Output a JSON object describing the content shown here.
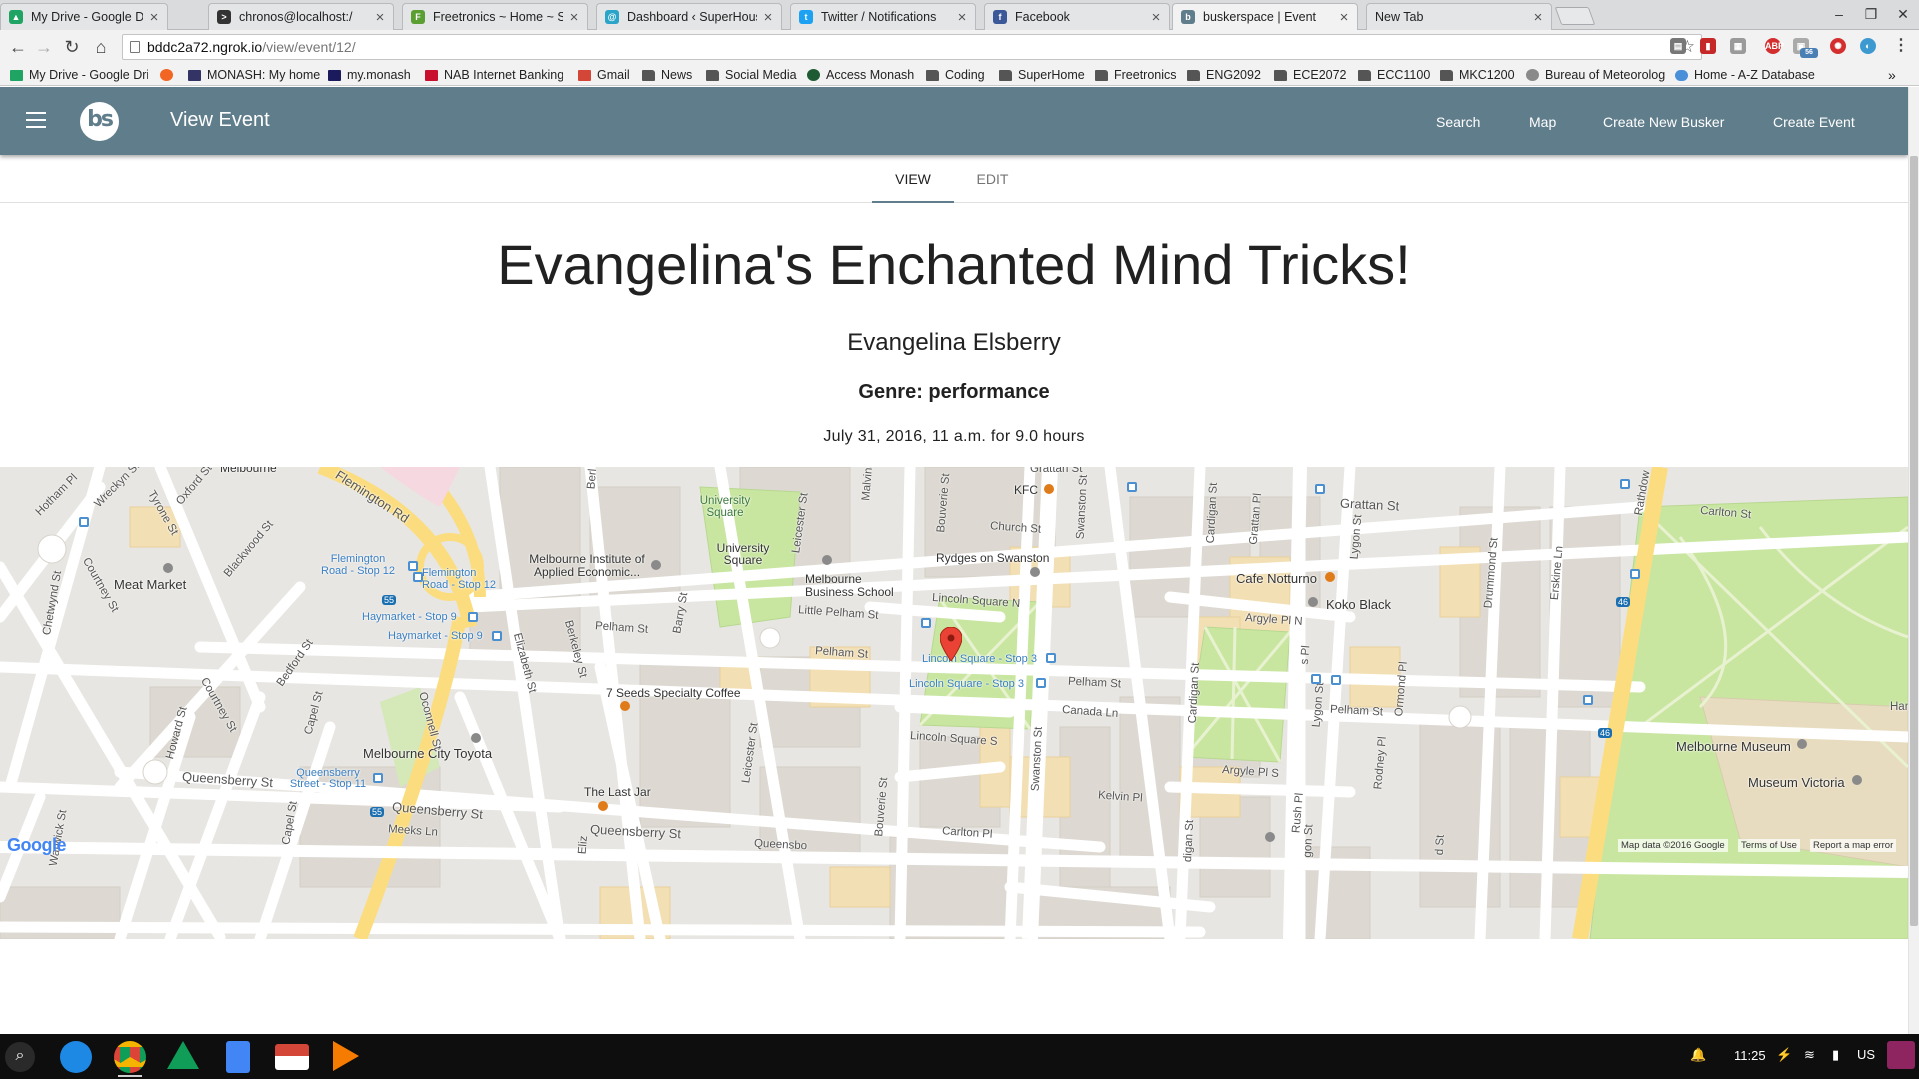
{
  "browser": {
    "tabs": [
      {
        "title": "My Drive - Google Drive",
        "favicon_color": "#1fa463",
        "active": false
      },
      {
        "title": "chronos@localhost:/",
        "favicon_color": "#333333",
        "active": false
      },
      {
        "title": "Freetronics ~ Home ~ Sh",
        "favicon_color": "#5b9e32",
        "active": false
      },
      {
        "title": "Dashboard ‹ SuperHouse",
        "favicon_color": "#2aa4c8",
        "active": false
      },
      {
        "title": "Twitter / Notifications",
        "favicon_color": "#1da1f2",
        "active": false
      },
      {
        "title": "Facebook",
        "favicon_color": "#3b5998",
        "active": false
      },
      {
        "title": "buskerspace | Event",
        "favicon_color": "#607d8b",
        "active": true
      },
      {
        "title": "New Tab",
        "favicon_color": "",
        "active": false
      }
    ],
    "url_host": "bddc2a72.ngrok.io",
    "url_path": "/view/event/12/",
    "bookmarks": [
      {
        "label": "My Drive - Google Driv",
        "icon": "drive-icon",
        "color": "#1fa463"
      },
      {
        "label": "",
        "icon": "orange-circle-icon",
        "color": "#f26522"
      },
      {
        "label": "MONASH: My home",
        "icon": "monash-icon",
        "color": "#333366"
      },
      {
        "label": "my.monash",
        "icon": "my-monash-icon",
        "color": "#1a1a5c"
      },
      {
        "label": "NAB Internet Banking",
        "icon": "nab-icon",
        "color": "#c8102e"
      },
      {
        "label": "Gmail",
        "icon": "gmail-icon",
        "color": "#d44638"
      },
      {
        "label": "News",
        "icon": "folder-icon",
        "color": "#555555"
      },
      {
        "label": "Social Media",
        "icon": "folder-icon",
        "color": "#555555"
      },
      {
        "label": "Access Monash",
        "icon": "access-monash-icon",
        "color": "#1e5a32"
      },
      {
        "label": "Coding",
        "icon": "folder-icon",
        "color": "#555555"
      },
      {
        "label": "SuperHome",
        "icon": "folder-icon",
        "color": "#555555"
      },
      {
        "label": "Freetronics",
        "icon": "folder-icon",
        "color": "#555555"
      },
      {
        "label": "ENG2092",
        "icon": "folder-icon",
        "color": "#555555"
      },
      {
        "label": "ECE2072",
        "icon": "folder-icon",
        "color": "#555555"
      },
      {
        "label": "ECC1100",
        "icon": "folder-icon",
        "color": "#555555"
      },
      {
        "label": "MKC1200",
        "icon": "folder-icon",
        "color": "#555555"
      },
      {
        "label": "Bureau of Meteorolog",
        "icon": "bom-icon",
        "color": "#8a8a8a"
      },
      {
        "label": "Home - A-Z Database",
        "icon": "cloud-icon",
        "color": "#4a90d9"
      }
    ],
    "bookmarks_overflow": "»"
  },
  "app": {
    "title": "View Event",
    "logo_text": "bs",
    "nav": [
      "Search",
      "Map",
      "Create New Busker",
      "Create Event"
    ],
    "colors": {
      "primary": "#607d8b"
    }
  },
  "view_tabs": [
    "VIEW",
    "EDIT"
  ],
  "event": {
    "title": "Evangelina's Enchanted Mind Tricks!",
    "busker": "Evangelina Elsberry",
    "genre_line": "Genre: performance",
    "time_line": "July 31, 2016, 11 a.m. for 9.0 hours"
  },
  "map": {
    "labels": {
      "melbourne": "Melbourne",
      "flemington_rd": "Flemington Rd",
      "flemington_stop_12a": "Flemington Road - Stop 12",
      "flemington_stop_12b": "Flemington Road - Stop 12",
      "meat_market": "Meat Market",
      "haymarket_9a": "Haymarket - Stop 9",
      "haymarket_9b": "Haymarket - Stop 9",
      "mia": "Melbourne Institute of Applied Economic...",
      "university_square_a": "University Square",
      "university_square_b": "University Square",
      "mbs": "Melbourne Business School",
      "little_pelham": "Little Pelham St",
      "pelham_a": "Pelham St",
      "pelham_b": "Pelham St",
      "pelham_c": "Pelham St",
      "pelham_d": "Pelham St",
      "rydges": "Rydges on Swanston",
      "kfc": "KFC",
      "grattan_a": "Grattan St",
      "grattan_b": "Grattan St",
      "church": "Church St",
      "lincoln_n": "Lincoln Square N",
      "lincoln_s": "Lincoln Square S",
      "lincoln_stop_3a": "Lincoln Square - Stop 3",
      "lincoln_stop_3b": "Lincoln Square - Stop 3",
      "cafe_notturno": "Cafe Notturno",
      "koko_black": "Koko Black",
      "argyle_n": "Argyle Pl N",
      "argyle_s": "Argyle Pl S",
      "canada_ln": "Canada Ln",
      "kelvin_pl": "Kelvin Pl",
      "carlton_st": "Carlton St",
      "carlton_pl": "Carlton Pl",
      "seven_seeds": "7 Seeds Specialty Coffee",
      "the_last_jar": "The Last Jar",
      "melbourne_city_toyota": "Melbourne City Toyota",
      "queensberry_a": "Queensberry St",
      "queensberry_b": "Queensberry St",
      "queensberry_c": "Queensberry St",
      "queensberry_d": "Queensbo",
      "queensberry_stop_11": "Queensberry Street - Stop 11",
      "melbourne_museum": "Melbourne Museum",
      "museum_victoria": "Museum Victoria",
      "rathdowne": "Rathdow",
      "hotham_pl": "Hotham Pl",
      "wreckyn": "Wreckyn St",
      "oxford": "Oxford St",
      "tyrone": "Tyrone St",
      "blackwood": "Blackwood St",
      "chetwynd": "Chetwynd St",
      "courtney_a": "Courtney St",
      "courtney_b": "Courtney St",
      "bedford": "Bedford St",
      "capel_a": "Capel St",
      "capel_b": "Capel St",
      "howard": "Howard St",
      "warwick": "Warwick St",
      "oconnell": "Oconnell St",
      "elizabeth": "Elizabeth St",
      "berkeley": "Berkeley St",
      "barry": "Barry St",
      "leicester_a": "Leicester St",
      "leicester_b": "Leicester St",
      "bouverie_a": "Bouverie St",
      "bouverie_b": "Bouverie St",
      "swanston_a": "Swanston St",
      "swanston_b": "Swanston St",
      "cardigan_a": "Cardigan St",
      "cardigan_b": "Cardigan St",
      "grattan_pl": "Grattan Pl",
      "lygon_a": "Lygon St",
      "lygon_b": "Lygon St",
      "drummond": "Drummond St",
      "erskine": "Erskine Ln",
      "ormond": "Ormond Pl",
      "rodney": "Rodney Pl",
      "rush": "Rush Pl",
      "meeks": "Meeks Ln",
      "malvina": "Malvina",
      "route_55a": "55",
      "route_55b": "55",
      "route_46a": "46",
      "route_46b": "46",
      "han": "Han",
      "berl": "Berl",
      "eliz": "Eliz",
      "digan": "digan St",
      "gon": "gon St",
      "d_st": "d St",
      "s_pl": "s Pl"
    },
    "footer": {
      "map_data": "Map data ©2016 Google",
      "terms": "Terms of Use",
      "report": "Report a map error"
    },
    "google_logo": "Google"
  },
  "shelf": {
    "apps": [
      "launcher-search-icon",
      "files-icon",
      "chrome-icon",
      "drive-icon",
      "docs-icon",
      "gmail-icon",
      "play-music-icon"
    ],
    "clock": "11:25",
    "ime": "US"
  }
}
